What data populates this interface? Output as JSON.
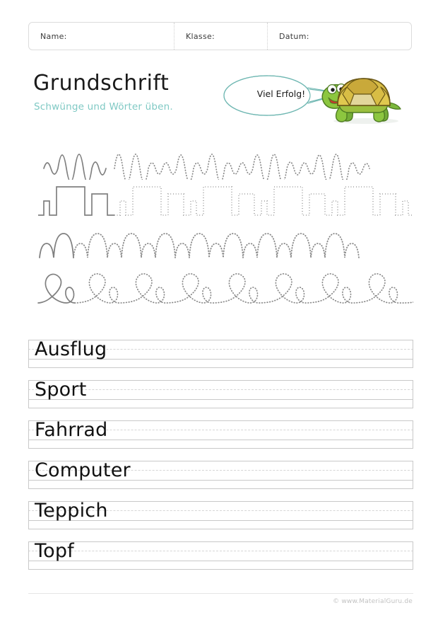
{
  "worksheet": {
    "title": "Grundschrift",
    "subtitle": "Schwünge und Wörter üben.",
    "accent_color": "#7fc9c4",
    "text_color": "#1a1a1a",
    "stroke_color": "#808080"
  },
  "header": {
    "fields": [
      {
        "label": "Name:",
        "value": ""
      },
      {
        "label": "Klasse:",
        "value": ""
      },
      {
        "label": "Datum:",
        "value": ""
      }
    ]
  },
  "mascot": {
    "bubble_text": "Viel Erfolg!",
    "bubble_color": "#6fb7b2",
    "character": "turtle",
    "shell_color": "#d4b63c",
    "body_color": "#6aa832"
  },
  "swing_rows": [
    {
      "name": "tall-wave-swing",
      "pattern": "alternating tall and short sine waves"
    },
    {
      "name": "square-wave-swing",
      "pattern": "alternating small notch and large rectangle"
    },
    {
      "name": "rounded-hump-swing",
      "pattern": "alternating small and large rounded humps"
    },
    {
      "name": "loop-swing",
      "pattern": "alternating large and small loops on a baseline"
    }
  ],
  "words": [
    {
      "text": "Ausflug"
    },
    {
      "text": "Sport"
    },
    {
      "text": "Fahrrad"
    },
    {
      "text": "Computer"
    },
    {
      "text": "Teppich"
    },
    {
      "text": "Topf"
    }
  ],
  "footer": {
    "copyright": "© www.MaterialGuru.de"
  }
}
